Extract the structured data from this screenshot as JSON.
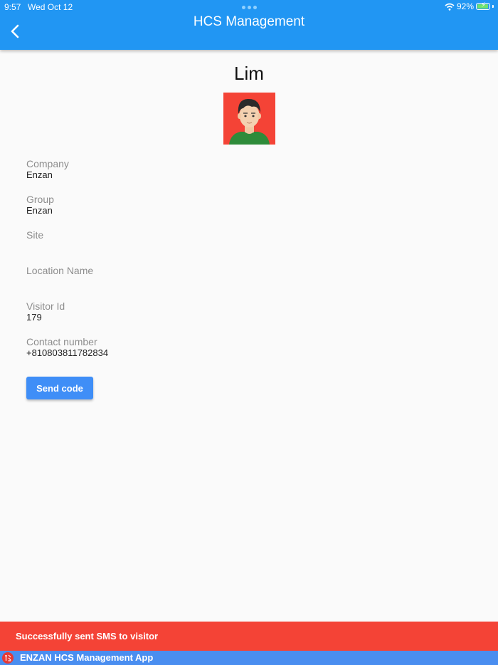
{
  "status_bar": {
    "time": "9:57",
    "date": "Wed Oct 12",
    "battery": "92%"
  },
  "header": {
    "title": "HCS Management"
  },
  "profile": {
    "name": "Lim",
    "fields": [
      {
        "label": "Company",
        "value": "Enzan"
      },
      {
        "label": "Group",
        "value": "Enzan"
      },
      {
        "label": "Site",
        "value": ""
      },
      {
        "label": "Location Name",
        "value": ""
      },
      {
        "label": "Visitor Id",
        "value": "179"
      },
      {
        "label": "Contact number",
        "value": "+810803811782834"
      }
    ]
  },
  "actions": {
    "send_code_label": "Send code"
  },
  "snackbar": {
    "message": "Successfully sent SMS to visitor"
  },
  "footer": {
    "app_name": "ENZAN HCS Management App"
  },
  "colors": {
    "appbar": "#2196f3",
    "button": "#3f8ef7",
    "snackbar": "#f44336",
    "footer": "#4a8ef0"
  }
}
